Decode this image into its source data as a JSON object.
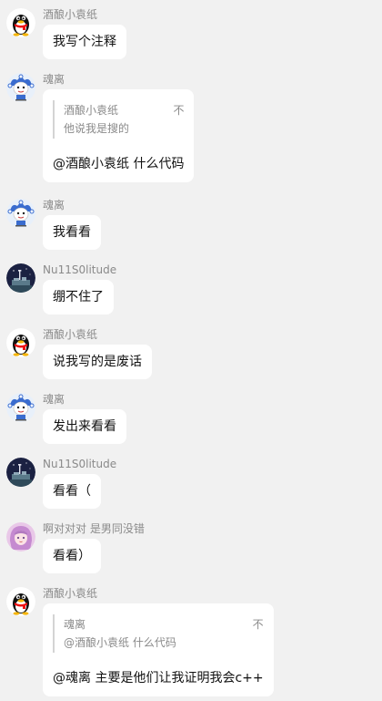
{
  "messages": [
    {
      "sender": "酒酿小袁纸",
      "avatar": "qq-penguin-avatar",
      "text": "我写个注释"
    },
    {
      "sender": "魂离",
      "avatar": "jester-avatar",
      "quote": {
        "name": "酒酿小袁纸",
        "text": "他说我是搜的",
        "close": "不"
      },
      "text": "@酒酿小袁纸 什么代码"
    },
    {
      "sender": "魂离",
      "avatar": "jester-avatar",
      "text": "我看看"
    },
    {
      "sender": "Nu11S0litude",
      "avatar": "night-scene-avatar",
      "text": "绷不住了"
    },
    {
      "sender": "酒酿小袁纸",
      "avatar": "qq-penguin-avatar",
      "text": "说我写的是废话"
    },
    {
      "sender": "魂离",
      "avatar": "jester-avatar",
      "text": "发出来看看"
    },
    {
      "sender": "Nu11S0litude",
      "avatar": "night-scene-avatar",
      "text": "看看（"
    },
    {
      "sender": "啊对对对 是男同没错",
      "avatar": "anime-girl-avatar",
      "text": "看看）"
    },
    {
      "sender": "酒酿小袁纸",
      "avatar": "qq-penguin-avatar",
      "quote": {
        "name": "魂离",
        "text": "@酒酿小袁纸 什么代码",
        "close": "不"
      },
      "text": "@魂离 主要是他们让我证明我会c++"
    }
  ]
}
